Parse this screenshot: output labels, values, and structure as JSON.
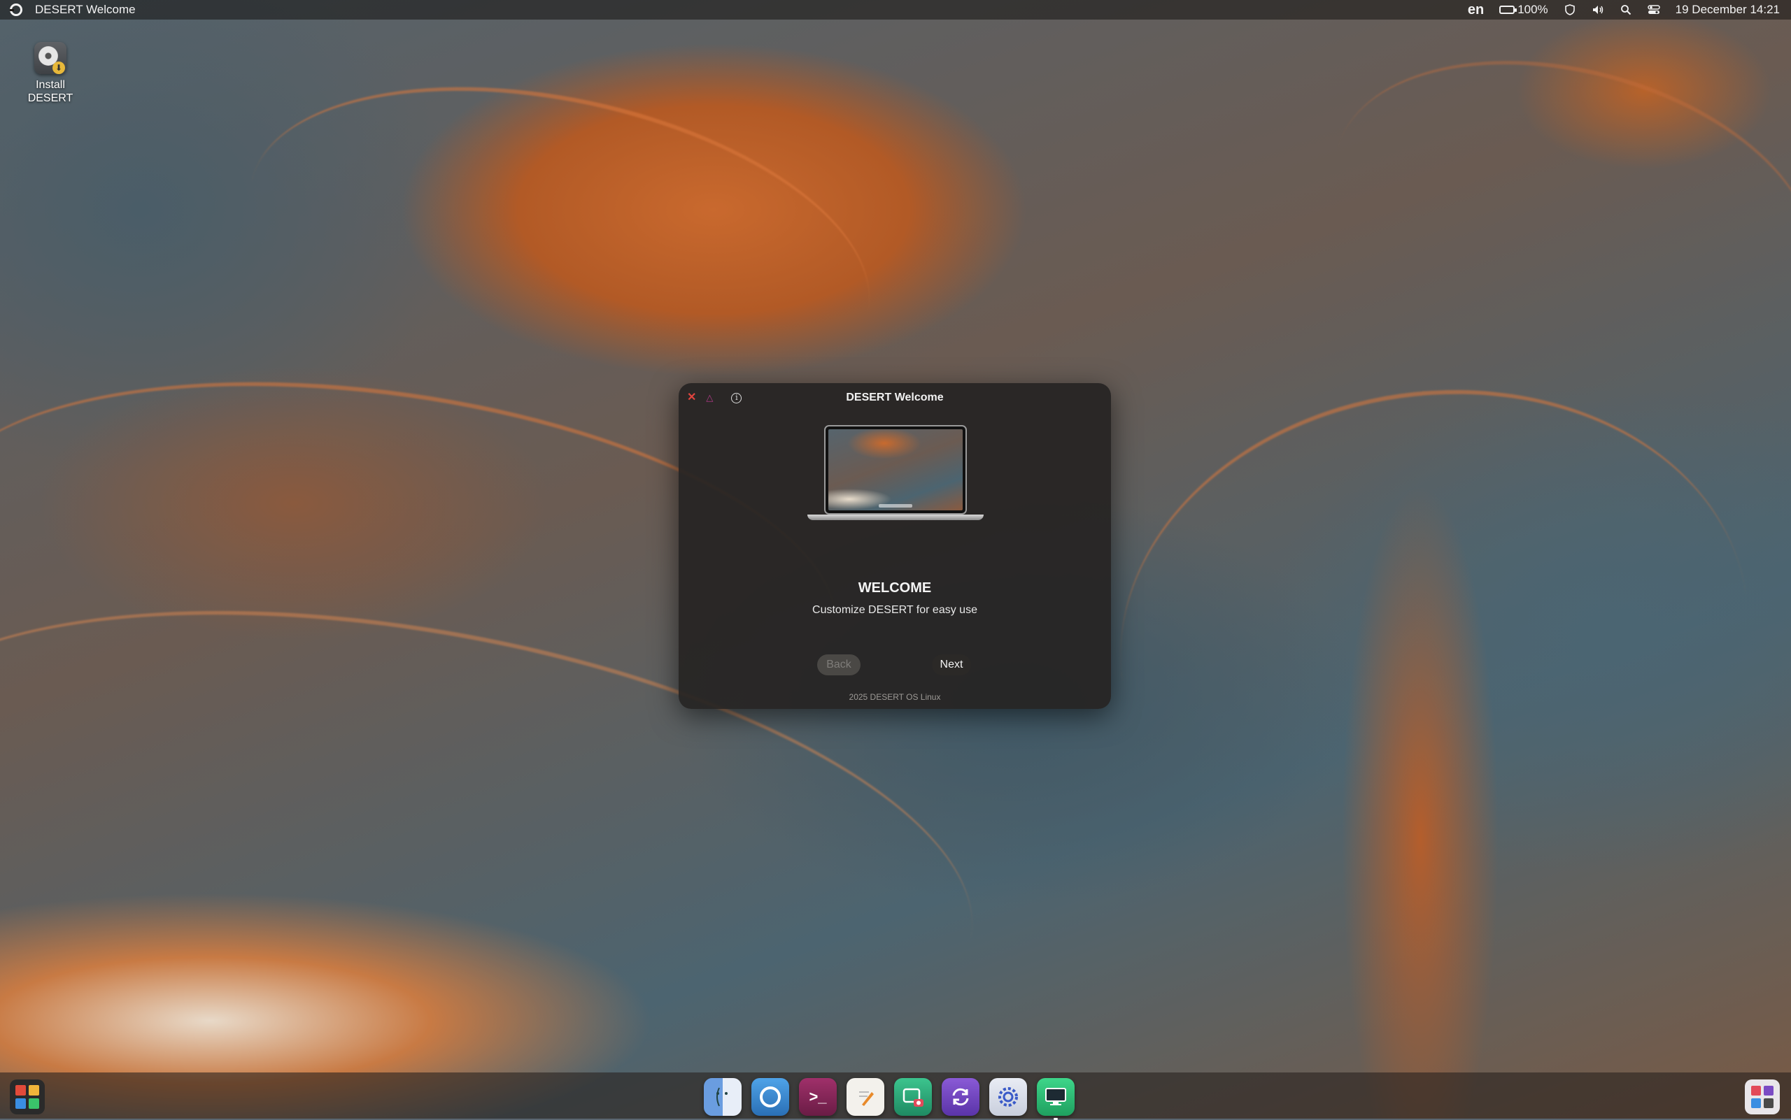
{
  "topbar": {
    "app_title": "DESERT Welcome",
    "language": "en",
    "battery": "100%",
    "datetime": "19 December 14:21",
    "icons": [
      "desert-logo-icon",
      "battery-icon",
      "shield-icon",
      "volume-icon",
      "search-icon",
      "control-center-icon"
    ]
  },
  "desktop": {
    "icon_label": "Install\nDESERT"
  },
  "window": {
    "title": "DESERT Welcome",
    "heading": "WELCOME",
    "subtitle": "Customize DESERT for easy use",
    "back_label": "Back",
    "next_label": "Next",
    "footer": "2025 DESERT OS Linux"
  },
  "dock": {
    "items": [
      {
        "name": "finder-icon",
        "color": "#5b8fd8"
      },
      {
        "name": "browser-icon",
        "color": "#3a86c8"
      },
      {
        "name": "terminal-icon",
        "color": "#8a2a5a"
      },
      {
        "name": "text-editor-icon",
        "color": "#f2f0ea"
      },
      {
        "name": "screenshot-icon",
        "color": "#2ea87a"
      },
      {
        "name": "update-icon",
        "color": "#7b4bc4"
      },
      {
        "name": "settings-icon",
        "color": "#4a66c8"
      },
      {
        "name": "welcome-app-icon",
        "color": "#35c47a"
      }
    ]
  }
}
